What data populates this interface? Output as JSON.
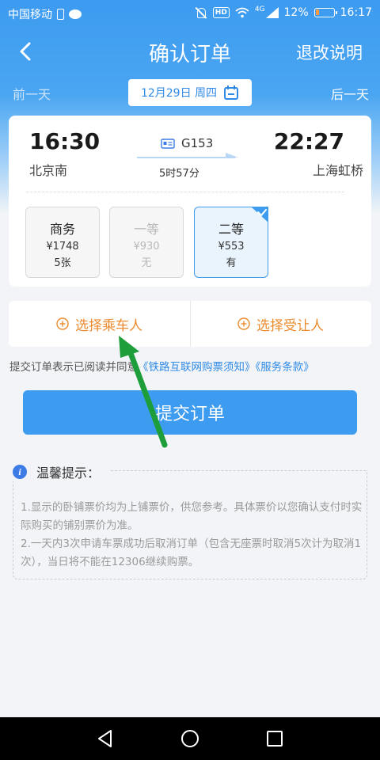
{
  "status_bar": {
    "carrier": "中国移动",
    "signal_label": "4G",
    "battery": "12%",
    "time": "16:17"
  },
  "nav": {
    "title": "确认订单",
    "right_label": "退改说明"
  },
  "date_bar": {
    "prev_label": "前一天",
    "date": "12月29日 周四",
    "next_label": "后一天"
  },
  "train": {
    "departure_time": "16:30",
    "departure_station": "北京南",
    "arrival_time": "22:27",
    "arrival_station": "上海虹桥",
    "number": "G153",
    "duration": "5时57分"
  },
  "seats": [
    {
      "name": "商务",
      "price": "¥1748",
      "availability": "5张",
      "state": "available"
    },
    {
      "name": "一等",
      "price": "¥930",
      "availability": "无",
      "state": "disabled"
    },
    {
      "name": "二等",
      "price": "¥553",
      "availability": "有",
      "state": "selected"
    }
  ],
  "passengers": {
    "select_passenger": "选择乘车人",
    "select_beneficiary": "选择受让人"
  },
  "agreement": {
    "prefix": "提交订单表示已阅读并同意",
    "link1": "《铁路互联网购票须知》",
    "link2": "《服务条款》"
  },
  "submit_label": "提交订单",
  "tips": {
    "title": "温馨提示：",
    "line1": "1.显示的卧铺票价均为上铺票价，供您参考。具体票价以您确认支付时实际购买的铺别票价为准。",
    "line2": "2.一天内3次申请车票成功后取消订单（包含无座票时取消5次计为取消1次），当日将不能在12306继续购票。"
  },
  "colors": {
    "primary": "#3d9bf0",
    "accent_orange": "#ec8b2e",
    "link_blue": "#2f8ae6",
    "annotation_green": "#1e9e3a"
  }
}
